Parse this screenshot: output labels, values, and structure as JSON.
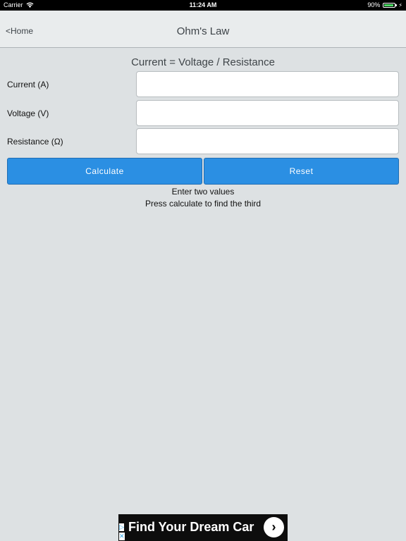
{
  "status_bar": {
    "carrier": "Carrier",
    "time": "11:24 AM",
    "battery": "90%",
    "battery_level": 0.9
  },
  "nav": {
    "back_label": "<Home",
    "title": "Ohm's Law"
  },
  "formula": "Current = Voltage / Resistance",
  "fields": [
    {
      "label": "Current (A)",
      "value": ""
    },
    {
      "label": "Voltage (V)",
      "value": ""
    },
    {
      "label": "Resistance (Ω)",
      "value": ""
    }
  ],
  "buttons": {
    "calculate": "Calculate",
    "reset": "Reset"
  },
  "hints": [
    "Enter two values",
    "Press calculate to find the third"
  ],
  "ad": {
    "text": "Find Your Dream Car",
    "arrow": "›",
    "choices": "▷",
    "close": "✕"
  },
  "colors": {
    "background": "#dde1e3",
    "button": "#2b8fe3",
    "battery": "#4cd964"
  }
}
